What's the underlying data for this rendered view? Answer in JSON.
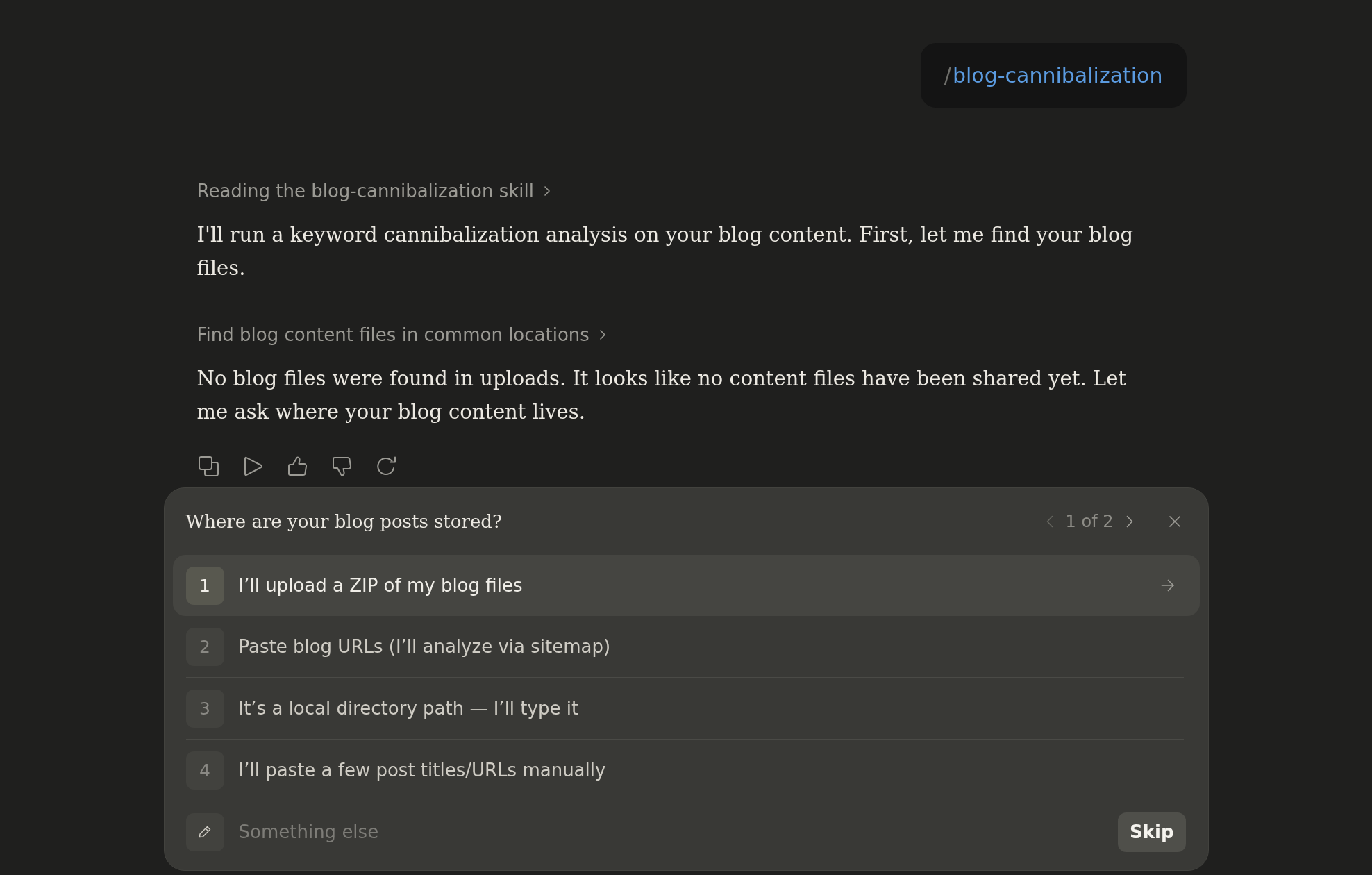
{
  "command_chip": {
    "slash": "/",
    "command": "blog-cannibalization"
  },
  "messages": [
    {
      "kind": "step",
      "label": "Reading the blog-cannibalization skill",
      "expanded": false
    },
    {
      "kind": "text",
      "text": "I'll run a keyword cannibalization analysis on your blog content. First, let me find your blog files."
    },
    {
      "kind": "step",
      "label": "Find blog content files in common locations",
      "expanded": false
    },
    {
      "kind": "text",
      "text": "No blog files were found in uploads. It looks like no content files have been shared yet. Let me ask where your blog content lives."
    }
  ],
  "question_panel": {
    "question": "Where are your blog posts stored?",
    "pager": {
      "text": "1 of 2",
      "prev_disabled": true,
      "next_disabled": false
    },
    "options": [
      {
        "number": "1",
        "label": "I’ll upload a ZIP of my blog files",
        "selected": true
      },
      {
        "number": "2",
        "label": "Paste blog URLs (I’ll analyze via sitemap)",
        "selected": false
      },
      {
        "number": "3",
        "label": "It’s a local directory path — I’ll type it",
        "selected": false
      },
      {
        "number": "4",
        "label": "I’ll paste a few post titles/URLs manually",
        "selected": false
      }
    ],
    "other": {
      "placeholder": "Something else"
    },
    "skip_button": "Skip"
  }
}
